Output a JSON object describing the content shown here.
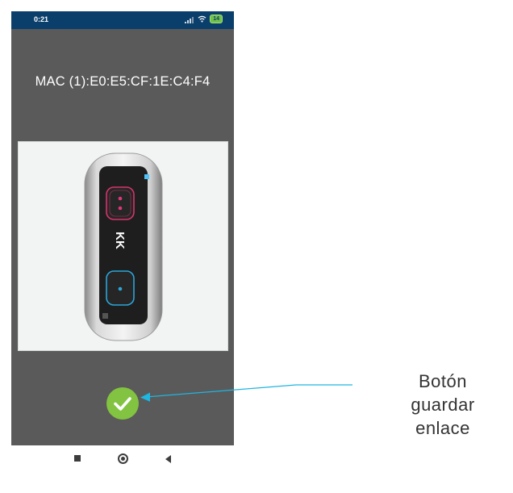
{
  "status_bar": {
    "time": "0:21",
    "battery": "14"
  },
  "mac_label": "MAC (1):E0:E5:CF:1E:C4:F4",
  "device_image": {
    "icon": "remote-control-device",
    "top_button_color": "#d6336c",
    "bottom_button_color": "#2aa6d9",
    "logo_text": "KK"
  },
  "confirm_button": {
    "icon": "checkmark-icon",
    "color": "#82c341"
  },
  "nav_bar": {
    "icons": [
      "recent-apps-icon",
      "home-icon",
      "back-icon"
    ]
  },
  "annotation": {
    "lines": [
      "Botón",
      "guardar",
      "enlace"
    ],
    "arrow_color": "#1fb6e0"
  }
}
